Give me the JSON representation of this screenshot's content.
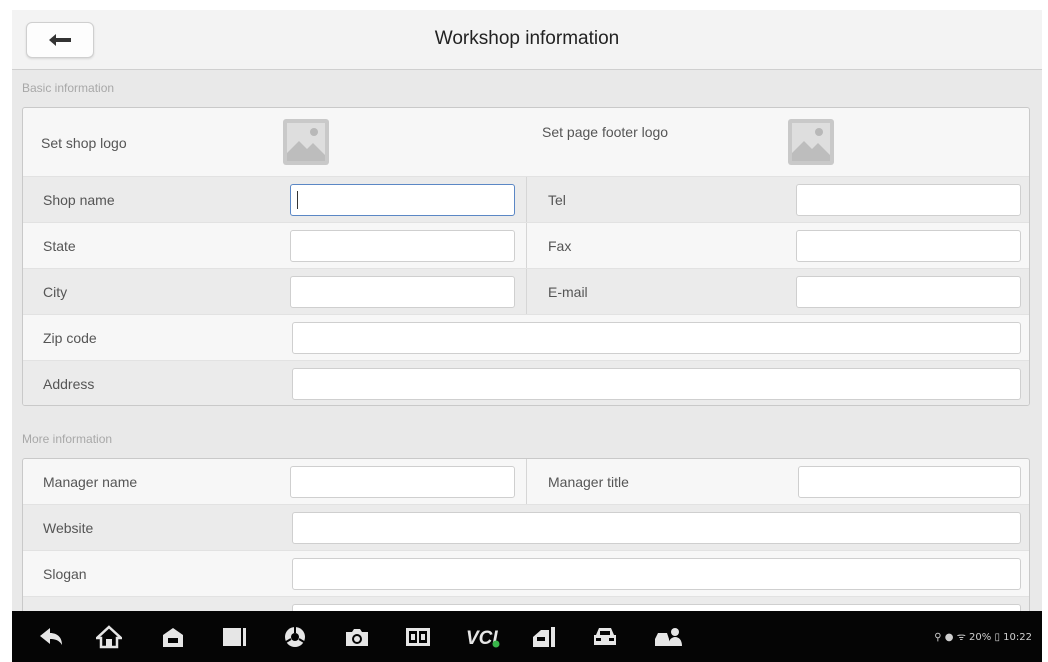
{
  "header": {
    "title": "Workshop information",
    "back_icon": "back-arrow-icon"
  },
  "basic": {
    "section_label": "Basic information",
    "shop_logo_label": "Set shop logo",
    "footer_logo_label": "Set page footer logo",
    "shop_name_label": "Shop name",
    "tel_label": "Tel",
    "state_label": "State",
    "fax_label": "Fax",
    "city_label": "City",
    "email_label": "E-mail",
    "zip_label": "Zip code",
    "address_label": "Address"
  },
  "more": {
    "section_label": "More information",
    "manager_name_label": "Manager name",
    "manager_title_label": "Manager title",
    "website_label": "Website",
    "slogan_label": "Slogan"
  },
  "taskbar": {
    "icons": [
      "back-icon",
      "home-icon",
      "shop-icon",
      "multitask-icon",
      "browser-icon",
      "camera-icon",
      "screen-mirror-icon",
      "vci-icon",
      "service-icon",
      "vehicle-icon",
      "remote-expert-icon"
    ],
    "status": "20%",
    "time": "10:22"
  },
  "colors": {
    "focus": "#5b87c5",
    "background": "#e9e9e9",
    "taskbar": "#050505"
  }
}
